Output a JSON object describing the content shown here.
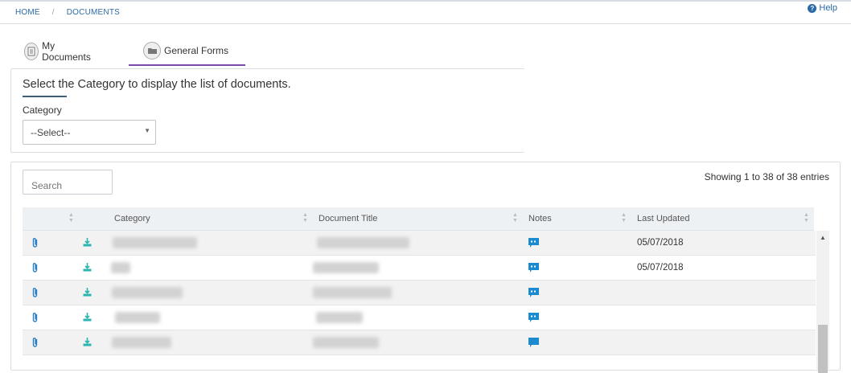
{
  "breadcrumb": {
    "home": "HOME",
    "separator": "/",
    "current": "DOCUMENTS"
  },
  "help": {
    "label": "Help",
    "icon": "question-circle-icon"
  },
  "tabs": [
    {
      "label": "My Documents",
      "icon": "document-icon",
      "active": false
    },
    {
      "label": "General Forms",
      "icon": "folder-icon",
      "active": true
    }
  ],
  "filter": {
    "heading": "Select the Category to display the list of documents.",
    "category_label": "Category",
    "select_value": "--Select--"
  },
  "table": {
    "search_placeholder": "Search",
    "showing": "Showing 1 to 38 of 38 entries",
    "columns": [
      "Category",
      "Document Title",
      "Notes",
      "Last Updated"
    ],
    "rows": [
      {
        "last_updated": "05/07/2018"
      },
      {
        "last_updated": "05/07/2018"
      },
      {
        "last_updated": ""
      },
      {
        "last_updated": ""
      },
      {
        "last_updated": ""
      }
    ]
  },
  "colors": {
    "link": "#2b6aa8",
    "accent": "#7a4aa8",
    "download": "#2bb5b0",
    "note": "#1b8bd0",
    "clip": "#2b7fc4"
  }
}
